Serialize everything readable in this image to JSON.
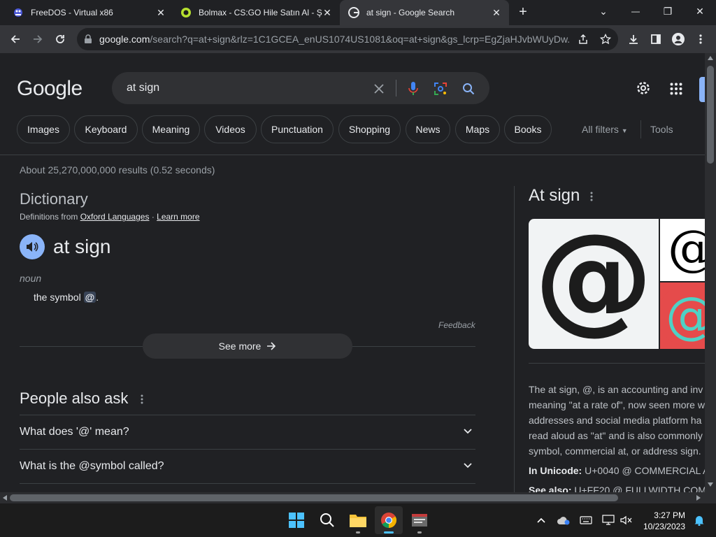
{
  "tabs": [
    {
      "title": "FreeDOS - Virtual x86",
      "close": "✕"
    },
    {
      "title": "Bolmax - CS:GO Hile Satın Al - Ş",
      "close": "✕"
    },
    {
      "title": "at sign - Google Search",
      "close": "✕"
    }
  ],
  "new_tab": "+",
  "window_controls": {
    "tab_search": "⌄",
    "minimize": "—",
    "restore": "❐",
    "close": "✕"
  },
  "address": {
    "domain": "google.com",
    "path": "/search?q=at+sign&rlz=1C1GCEA_enUS1074US1081&oq=at+sign&gs_lcrp=EgZjaHJvbWUyDw..."
  },
  "google": {
    "logo": "Google",
    "query": "at sign",
    "chips": [
      "Images",
      "Keyboard",
      "Meaning",
      "Videos",
      "Punctuation",
      "Shopping",
      "News",
      "Maps",
      "Books"
    ],
    "all_filters": "All filters",
    "tools": "Tools",
    "results_stats": "About 25,270,000,000 results (0.52 seconds)"
  },
  "dictionary": {
    "heading": "Dictionary",
    "definitions_from": "Definitions from",
    "source": "Oxford Languages",
    "separator": "·",
    "learn_more": "Learn more",
    "word": "at sign",
    "part_of_speech": "noun",
    "definition_prefix": "the symbol",
    "definition_symbol": "@",
    "definition_suffix": ".",
    "feedback": "Feedback",
    "see_more": "See more"
  },
  "people_also_ask": {
    "heading": "People also ask",
    "questions": [
      "What does '@' mean?",
      "What is the @symbol called?"
    ]
  },
  "knowledge_panel": {
    "title": "At sign",
    "description_lines": [
      "The at sign, @, is an accounting and inv",
      "meaning \"at a rate of\", now seen more w",
      "addresses and social media platform ha",
      "read aloud as \"at\" and is also commonly",
      "symbol, commercial at, or address sign."
    ],
    "unicode_label": "In Unicode:",
    "unicode_value": "U+0040 @ COMMERCIAL A",
    "see_also_label": "See also:",
    "see_also_value": "U+FF20 @ FULLWIDTH COM"
  },
  "taskbar": {
    "time": "3:27 PM",
    "date": "10/23/2023"
  }
}
